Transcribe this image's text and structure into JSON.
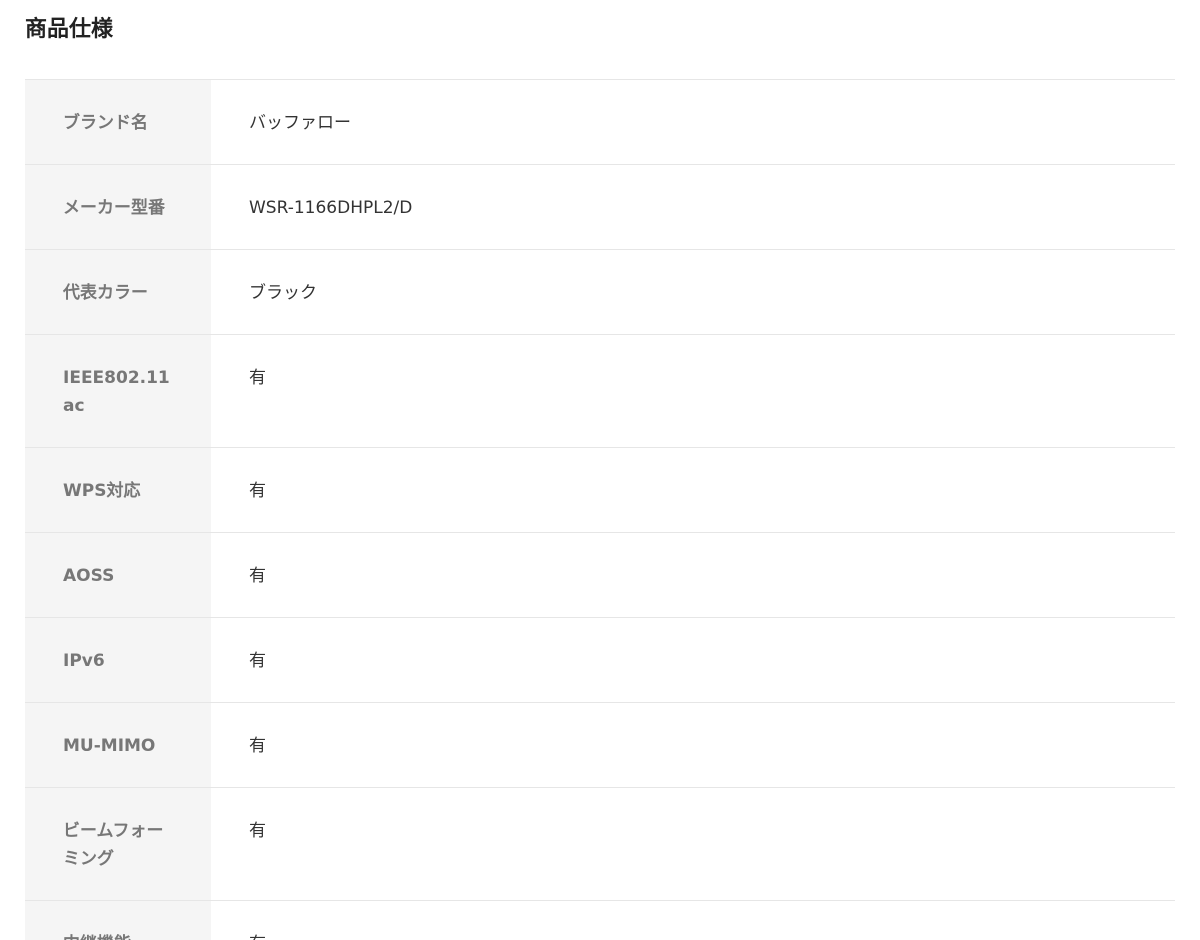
{
  "title": "商品仕様",
  "specs": [
    {
      "label": "ブランド名",
      "value": "バッファロー"
    },
    {
      "label": "メーカー型番",
      "value": "WSR-1166DHPL2/D"
    },
    {
      "label": "代表カラー",
      "value": "ブラック"
    },
    {
      "label": "IEEE802.11ac",
      "value": "有"
    },
    {
      "label": "WPS対応",
      "value": "有"
    },
    {
      "label": "AOSS",
      "value": "有"
    },
    {
      "label": "IPv6",
      "value": "有"
    },
    {
      "label": "MU-MIMO",
      "value": "有"
    },
    {
      "label": "ビームフォーミング",
      "value": "有"
    },
    {
      "label": "中継機能",
      "value": "有"
    }
  ]
}
